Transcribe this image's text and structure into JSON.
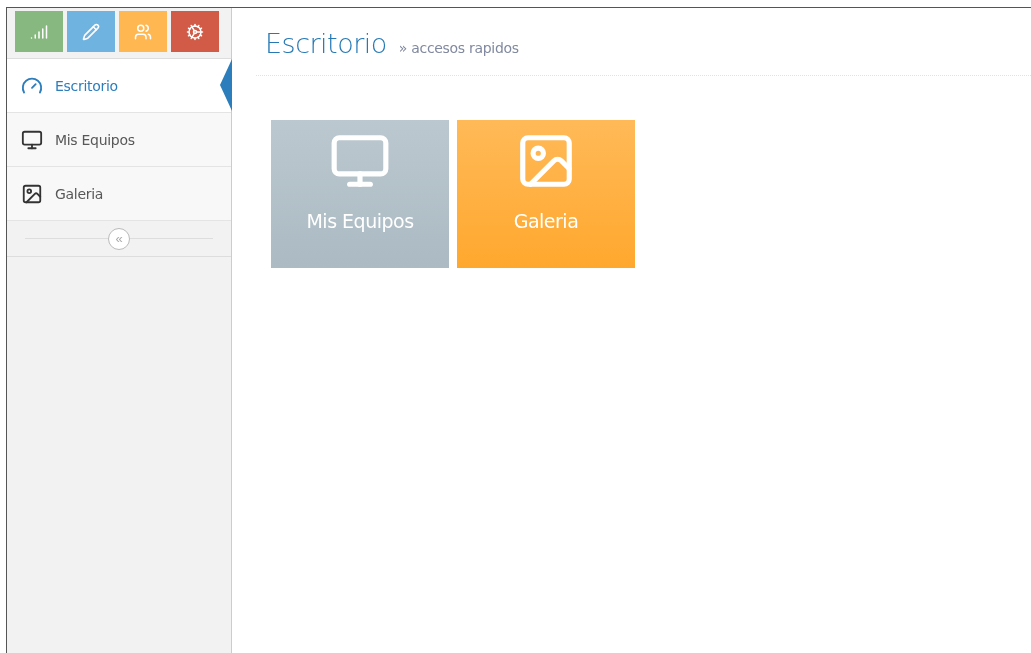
{
  "shortcuts": [
    {
      "kind": "signal",
      "color": "#87b87f"
    },
    {
      "kind": "pencil",
      "color": "#6fb3e0"
    },
    {
      "kind": "users",
      "color": "#ffb752"
    },
    {
      "kind": "cogs",
      "color": "#d15b47"
    }
  ],
  "sidebar": {
    "items": [
      {
        "label": "Escritorio",
        "kind": "gauge",
        "selected": true
      },
      {
        "label": "Mis Equipos",
        "kind": "monitor",
        "selected": false
      },
      {
        "label": "Galeria",
        "kind": "image",
        "selected": false
      }
    ],
    "collapse": "«"
  },
  "page_header": {
    "title": "Escritorio",
    "subtitle": "» accesos rapidos"
  },
  "tiles": [
    {
      "label": "Mis Equipos",
      "kind": "monitor",
      "color": "#abbac3"
    },
    {
      "label": "Galeria",
      "kind": "image",
      "color": "#ffa82e"
    }
  ]
}
